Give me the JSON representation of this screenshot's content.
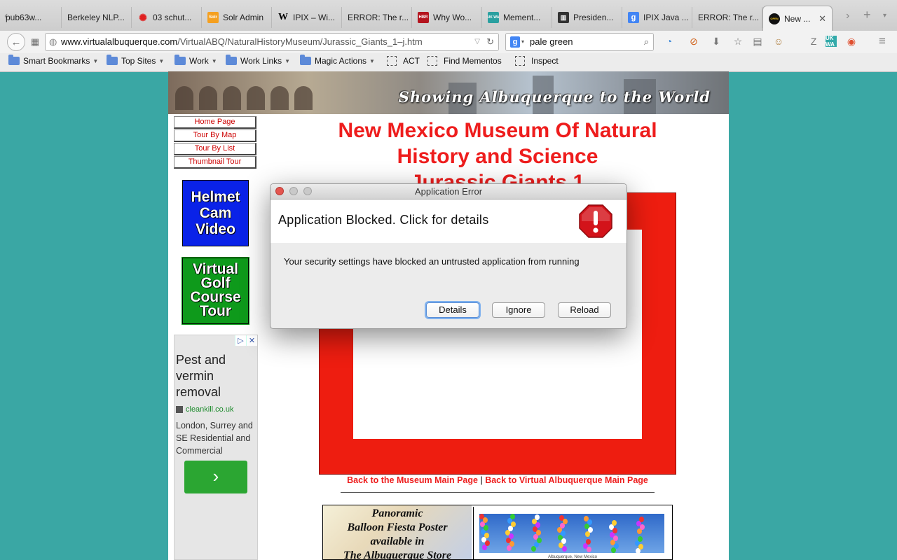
{
  "browser": {
    "tabs": [
      {
        "label": "pub63w...",
        "favicon": "none"
      },
      {
        "label": "Berkeley NLP...",
        "favicon": "none"
      },
      {
        "label": "03 schut...",
        "favicon": "red-dots"
      },
      {
        "label": "Solr Admin",
        "favicon": "solr"
      },
      {
        "label": "IPIX – Wi...",
        "favicon": "wikipedia"
      },
      {
        "label": "ERROR: The r...",
        "favicon": "none"
      },
      {
        "label": "Why Wo...",
        "favicon": "hbr"
      },
      {
        "label": "Mement...",
        "favicon": "ukwa"
      },
      {
        "label": "Presiden...",
        "favicon": "building"
      },
      {
        "label": "IPIX Java ...",
        "favicon": "google"
      },
      {
        "label": "ERROR: The r...",
        "favicon": "none"
      },
      {
        "label": "New ...",
        "favicon": "open"
      }
    ],
    "favicon_texts": {
      "hbr": "HBR",
      "ukwa": "UK WA",
      "wikipedia": "W",
      "google": "g",
      "open": "OPEN",
      "solr": "Solr"
    },
    "url": {
      "host": "www.virtualalbuquerque.com",
      "path": "/VirtualABQ/NaturalHistoryMuseum/Jurassic_Giants_1–j.htm"
    },
    "search_value": "pale green",
    "bookmarks": [
      {
        "label": "Smart Bookmarks",
        "type": "folder"
      },
      {
        "label": "Top Sites",
        "type": "folder"
      },
      {
        "label": "Work",
        "type": "folder"
      },
      {
        "label": "Work Links",
        "type": "folder"
      },
      {
        "label": "Magic Actions",
        "type": "folder"
      },
      {
        "label": "ACT",
        "type": "bookmarklet"
      },
      {
        "label": "Find Mementos",
        "type": "bookmarklet"
      },
      {
        "label": "Inspect",
        "type": "bookmarklet"
      }
    ]
  },
  "page": {
    "banner_tagline": "Showing Albuquerque to the World",
    "nav": [
      "Home Page",
      "Tour By Map",
      "Tour By List",
      "Thumbnail Tour"
    ],
    "promo_helmet": "Helmet Cam Video",
    "promo_golf": "Virtual Golf Course Tour",
    "ad": {
      "headline": "Pest and vermin removal",
      "domain": "cleankill.co.uk",
      "body": "London, Surrey and SE Residential and Commercial",
      "cta": "›"
    },
    "title_lines": [
      "New Mexico Museum Of Natural",
      "History and Science",
      "Jurassic Giants 1"
    ],
    "back_museum": "Back to the Museum Main Page",
    "back_separator": "|",
    "back_virtual": "Back to Virtual Albuquerque Main Page",
    "poster_text": [
      "Panoramic",
      "Balloon Fiesta Poster",
      "available in",
      "The Albuquerque Store"
    ],
    "poster_caption": "Albuquerque, New Mexico"
  },
  "dialog": {
    "window_title": "Application Error",
    "heading": "Application Blocked. Click for details",
    "message": "Your security settings have blocked an untrusted application from running",
    "buttons": {
      "details": "Details",
      "ignore": "Ignore",
      "reload": "Reload"
    }
  },
  "colors": {
    "page_bg": "#3aa7a4",
    "title_red": "#ee1d1d",
    "frame_red": "#ee1d10",
    "helmet_blue": "#0a22e8",
    "golf_green": "#0e9a1b"
  }
}
